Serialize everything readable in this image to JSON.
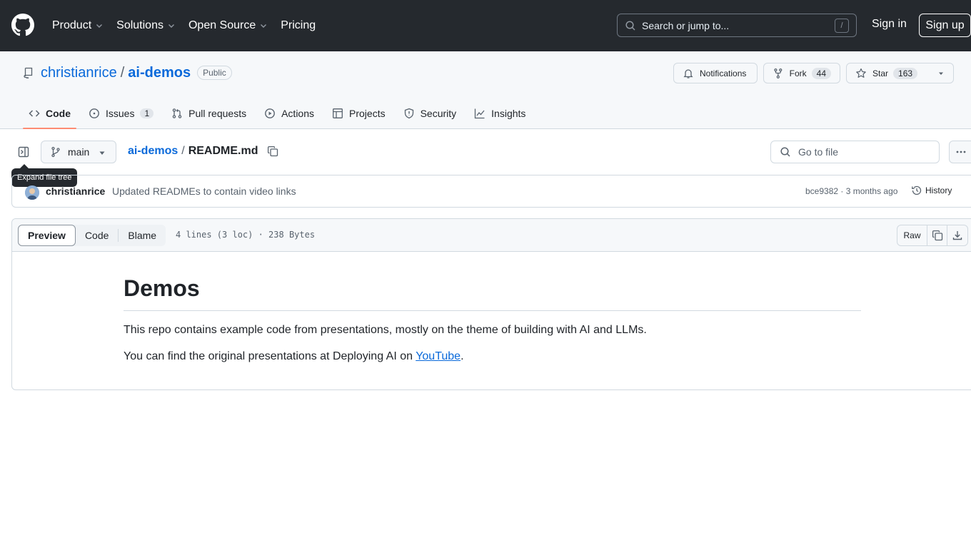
{
  "topbar": {
    "nav": [
      "Product",
      "Solutions",
      "Open Source",
      "Pricing"
    ],
    "search_placeholder": "Search or jump to...",
    "search_key": "/",
    "sign_in": "Sign in",
    "sign_up": "Sign up"
  },
  "repo": {
    "owner": "christianrice",
    "separator": "/",
    "name": "ai-demos",
    "visibility": "Public",
    "notifications_label": "Notifications",
    "fork_label": "Fork",
    "fork_count": "44",
    "star_label": "Star",
    "star_count": "163"
  },
  "tabs": [
    {
      "label": "Code",
      "icon": "code-icon",
      "active": true
    },
    {
      "label": "Issues",
      "icon": "issue-icon",
      "count": "1"
    },
    {
      "label": "Pull requests",
      "icon": "pull-request-icon"
    },
    {
      "label": "Actions",
      "icon": "play-icon"
    },
    {
      "label": "Projects",
      "icon": "table-icon"
    },
    {
      "label": "Security",
      "icon": "shield-icon"
    },
    {
      "label": "Insights",
      "icon": "graph-icon"
    }
  ],
  "filenav": {
    "tooltip": "Expand file tree",
    "branch": "main",
    "crumb_repo": "ai-demos",
    "crumb_sep": "/",
    "crumb_file": "README.md",
    "go_to_file": "Go to file"
  },
  "commit": {
    "author": "christianrice",
    "message": "Updated READMEs to contain video links",
    "meta": "bce9382 · 3 months ago",
    "history_label": "History"
  },
  "file": {
    "views": [
      "Preview",
      "Code",
      "Blame"
    ],
    "info": "4 lines (3 loc) · 238 Bytes",
    "raw_label": "Raw"
  },
  "readme": {
    "heading": "Demos",
    "para1": "This repo contains example code from presentations, mostly on the theme of building with AI and LLMs.",
    "para2_prefix": "You can find the original presentations at Deploying AI on ",
    "para2_link": "YouTube",
    "para2_suffix": "."
  },
  "colors": {
    "header_bg": "#25292e",
    "link": "#0969da",
    "tab_underline": "#fd8c73"
  }
}
